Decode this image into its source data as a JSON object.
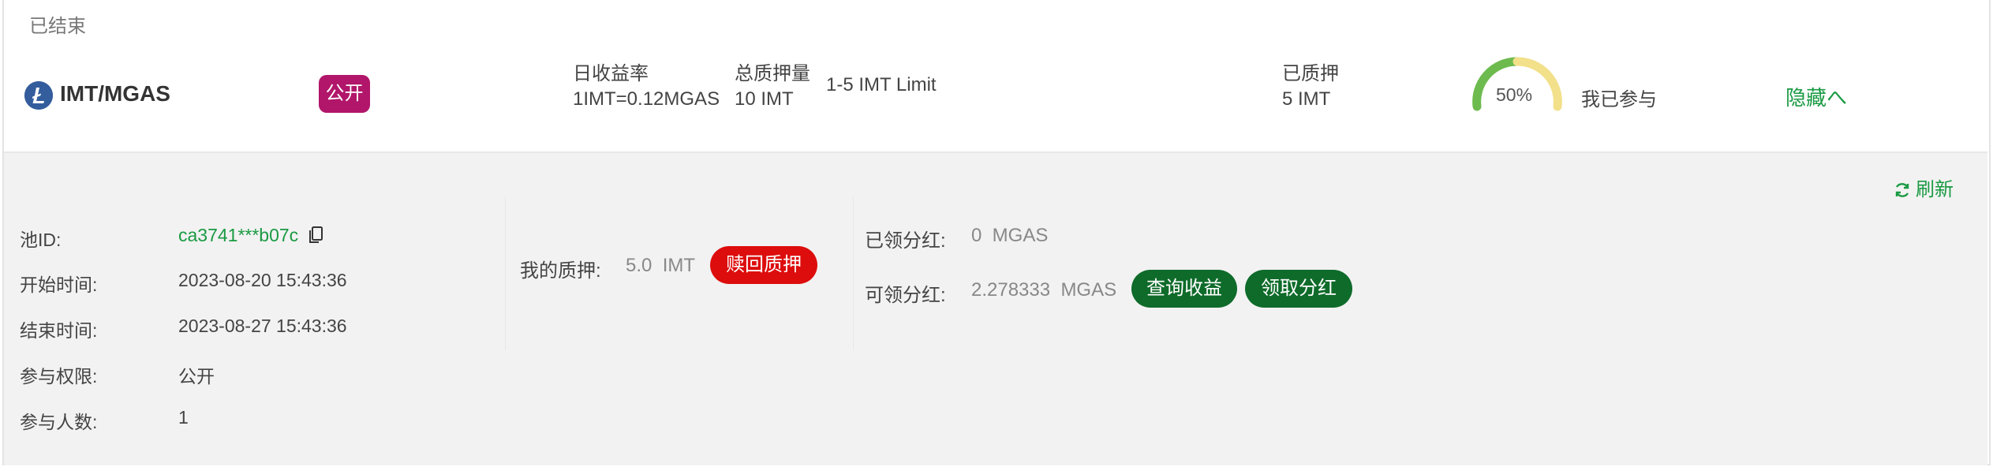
{
  "status": "已结束",
  "pool": {
    "pair": "IMT/MGAS",
    "access_badge": "公开",
    "daily_rate_label": "日收益率",
    "daily_rate_value": "1IMT=0.12MGAS",
    "total_stake_label": "总质押量",
    "total_stake_value": "10 IMT",
    "limit": "1-5 IMT Limit",
    "staked_label": "已质押",
    "staked_value": "5 IMT",
    "progress_percent": 50,
    "progress_text": "50%",
    "joined_text": "我已参与",
    "hide_label": "隐藏へ",
    "coin_icon": "litecoin-icon",
    "badge_color": "#b1166a"
  },
  "detail": {
    "refresh_label": "刷新",
    "pool_id_label": "池ID:",
    "pool_id_value": "ca3741***b07c",
    "start_label": "开始时间:",
    "start_value": "2023-08-20 15:43:36",
    "end_label": "结束时间:",
    "end_value": "2023-08-27 15:43:36",
    "permission_label": "参与权限:",
    "permission_value": "公开",
    "participants_label": "参与人数:",
    "participants_value": "1",
    "my_stake_label": "我的质押:",
    "my_stake_value": "5.0  IMT",
    "redeem_button": "赎回质押",
    "claimed_label": "已领分红:",
    "claimed_value": "0  MGAS",
    "claimable_label": "可领分红:",
    "claimable_value": "2.278333  MGAS",
    "query_button": "查询收益",
    "claim_button": "领取分红"
  },
  "colors": {
    "accent_green": "#1a9a43",
    "button_green": "#0e6b2a",
    "button_red": "#dd0d0d",
    "gauge_green": "#6dbb4f",
    "gauge_yellow": "#f2e08a"
  }
}
